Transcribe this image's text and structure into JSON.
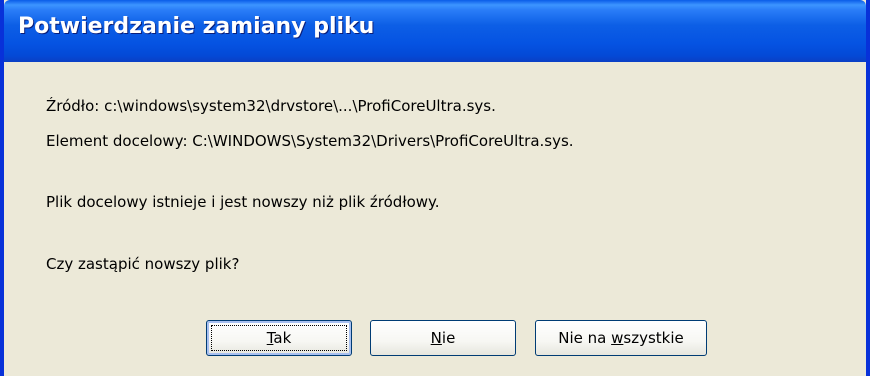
{
  "window": {
    "title": "Potwierdzanie zamiany pliku"
  },
  "message": {
    "source_line": "Źródło: c:\\windows\\system32\\drvstore\\...\\ProfiCoreUltra.sys.",
    "target_line": "Element docelowy: C:\\WINDOWS\\System32\\Drivers\\ProfiCoreUltra.sys.",
    "info_line": "Plik docelowy istnieje i jest nowszy niż plik źródłowy.",
    "question_line": "Czy zastąpić nowszy plik?"
  },
  "buttons": {
    "yes": {
      "accel": "T",
      "rest": "ak"
    },
    "no": {
      "accel": "N",
      "rest": "ie"
    },
    "no_to_all": {
      "prefix": "Nie na ",
      "accel": "w",
      "rest": "szystkie"
    }
  },
  "colors": {
    "titlebar": "#0553e2",
    "frame": "#0831d9",
    "dialog_bg": "#ece9d8",
    "button_border": "#003c74"
  }
}
